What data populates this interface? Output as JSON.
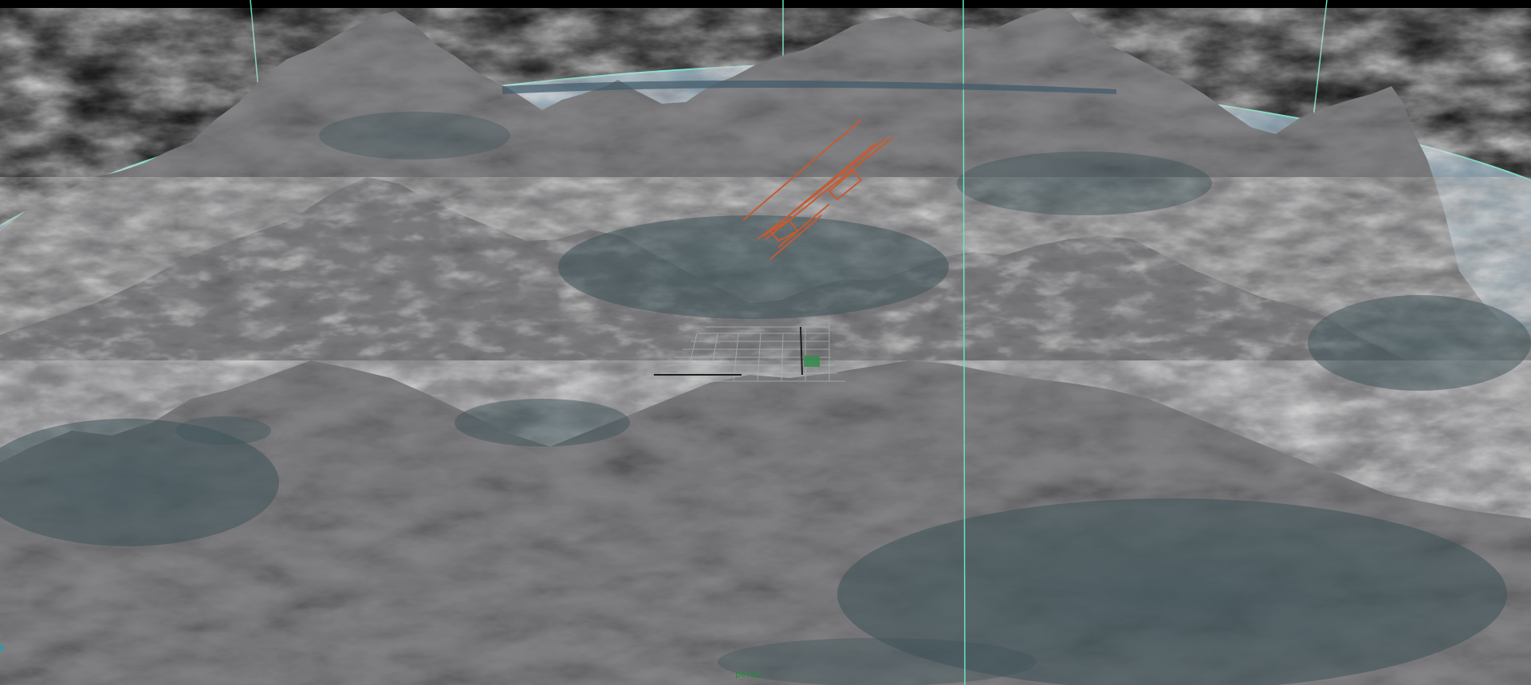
{
  "viewport": {
    "camera_name": "persp"
  },
  "colors": {
    "background": "#000000",
    "sky_dome_edge": "#61e6c2",
    "sky_dome_fill": "#6c8797",
    "terrain_base": "#7e7e80",
    "terrain_dark": "#4a4a4d",
    "water_plane": "#3e5156",
    "camera_wireframe": "#c65a30",
    "ground_grid": "#a8b4b0",
    "camera_label": "#1f8f3a"
  }
}
